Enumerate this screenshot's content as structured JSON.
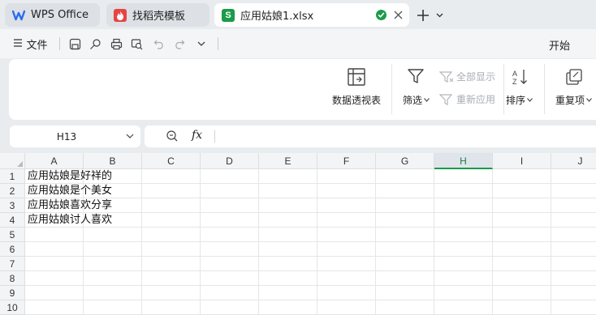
{
  "tabs": [
    {
      "label": "WPS Office",
      "icon": "wps-logo-icon",
      "color": "#2b6cf0"
    },
    {
      "label": "找稻壳模板",
      "icon": "docer-icon",
      "color": "#e64545"
    },
    {
      "label": "应用姑娘1.xlsx",
      "icon": "spreadsheet-s-icon",
      "color": "#1a9c4b",
      "active": true
    }
  ],
  "menu": {
    "file_label": "文件",
    "home_label": "开始"
  },
  "ribbon": {
    "pivot_label": "数据透视表",
    "filter_label": "筛选",
    "show_all_label": "全部显示",
    "reapply_label": "重新应用",
    "sort_label": "排序",
    "duplicates_label": "重复项"
  },
  "formula_bar": {
    "cell_ref": "H13",
    "fx_label": "fx",
    "formula_value": ""
  },
  "sheet": {
    "selected_column": "H",
    "columns": [
      "A",
      "B",
      "C",
      "D",
      "E",
      "F",
      "G",
      "H",
      "I",
      "J"
    ],
    "rows": [
      "1",
      "2",
      "3",
      "4",
      "5",
      "6",
      "7",
      "8",
      "9",
      "10"
    ],
    "cells": {
      "A1": "应用姑娘是好祥的",
      "A2": "应用姑娘是个美女",
      "A3": "应用姑娘喜欢分享",
      "A4": "应用姑娘讨人喜欢"
    }
  },
  "colors": {
    "accent": "#1a9c4b",
    "background": "#e9ecef"
  }
}
